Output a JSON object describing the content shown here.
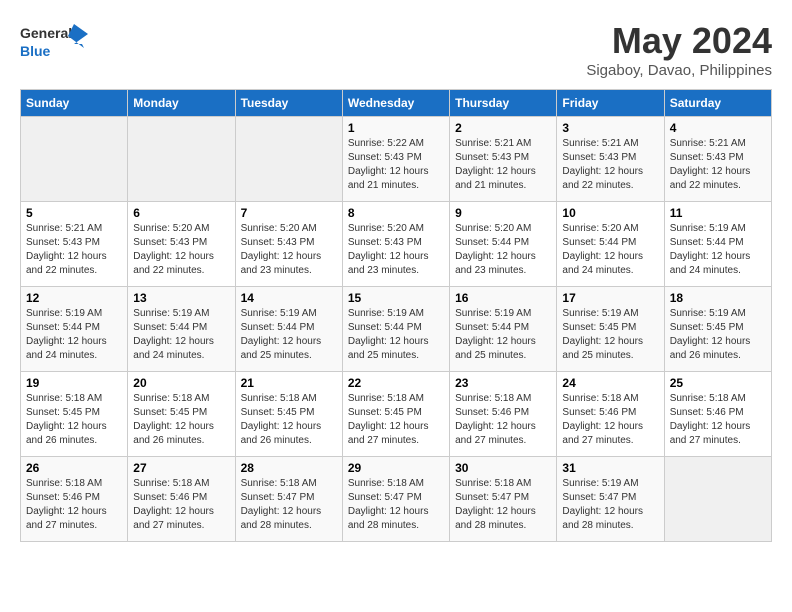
{
  "logo": {
    "line1": "General",
    "line2": "Blue"
  },
  "title": "May 2024",
  "location": "Sigaboy, Davao, Philippines",
  "days_of_week": [
    "Sunday",
    "Monday",
    "Tuesday",
    "Wednesday",
    "Thursday",
    "Friday",
    "Saturday"
  ],
  "weeks": [
    [
      {
        "day": "",
        "info": ""
      },
      {
        "day": "",
        "info": ""
      },
      {
        "day": "",
        "info": ""
      },
      {
        "day": "1",
        "info": "Sunrise: 5:22 AM\nSunset: 5:43 PM\nDaylight: 12 hours and 21 minutes."
      },
      {
        "day": "2",
        "info": "Sunrise: 5:21 AM\nSunset: 5:43 PM\nDaylight: 12 hours and 21 minutes."
      },
      {
        "day": "3",
        "info": "Sunrise: 5:21 AM\nSunset: 5:43 PM\nDaylight: 12 hours and 22 minutes."
      },
      {
        "day": "4",
        "info": "Sunrise: 5:21 AM\nSunset: 5:43 PM\nDaylight: 12 hours and 22 minutes."
      }
    ],
    [
      {
        "day": "5",
        "info": "Sunrise: 5:21 AM\nSunset: 5:43 PM\nDaylight: 12 hours and 22 minutes."
      },
      {
        "day": "6",
        "info": "Sunrise: 5:20 AM\nSunset: 5:43 PM\nDaylight: 12 hours and 22 minutes."
      },
      {
        "day": "7",
        "info": "Sunrise: 5:20 AM\nSunset: 5:43 PM\nDaylight: 12 hours and 23 minutes."
      },
      {
        "day": "8",
        "info": "Sunrise: 5:20 AM\nSunset: 5:43 PM\nDaylight: 12 hours and 23 minutes."
      },
      {
        "day": "9",
        "info": "Sunrise: 5:20 AM\nSunset: 5:44 PM\nDaylight: 12 hours and 23 minutes."
      },
      {
        "day": "10",
        "info": "Sunrise: 5:20 AM\nSunset: 5:44 PM\nDaylight: 12 hours and 24 minutes."
      },
      {
        "day": "11",
        "info": "Sunrise: 5:19 AM\nSunset: 5:44 PM\nDaylight: 12 hours and 24 minutes."
      }
    ],
    [
      {
        "day": "12",
        "info": "Sunrise: 5:19 AM\nSunset: 5:44 PM\nDaylight: 12 hours and 24 minutes."
      },
      {
        "day": "13",
        "info": "Sunrise: 5:19 AM\nSunset: 5:44 PM\nDaylight: 12 hours and 24 minutes."
      },
      {
        "day": "14",
        "info": "Sunrise: 5:19 AM\nSunset: 5:44 PM\nDaylight: 12 hours and 25 minutes."
      },
      {
        "day": "15",
        "info": "Sunrise: 5:19 AM\nSunset: 5:44 PM\nDaylight: 12 hours and 25 minutes."
      },
      {
        "day": "16",
        "info": "Sunrise: 5:19 AM\nSunset: 5:44 PM\nDaylight: 12 hours and 25 minutes."
      },
      {
        "day": "17",
        "info": "Sunrise: 5:19 AM\nSunset: 5:45 PM\nDaylight: 12 hours and 25 minutes."
      },
      {
        "day": "18",
        "info": "Sunrise: 5:19 AM\nSunset: 5:45 PM\nDaylight: 12 hours and 26 minutes."
      }
    ],
    [
      {
        "day": "19",
        "info": "Sunrise: 5:18 AM\nSunset: 5:45 PM\nDaylight: 12 hours and 26 minutes."
      },
      {
        "day": "20",
        "info": "Sunrise: 5:18 AM\nSunset: 5:45 PM\nDaylight: 12 hours and 26 minutes."
      },
      {
        "day": "21",
        "info": "Sunrise: 5:18 AM\nSunset: 5:45 PM\nDaylight: 12 hours and 26 minutes."
      },
      {
        "day": "22",
        "info": "Sunrise: 5:18 AM\nSunset: 5:45 PM\nDaylight: 12 hours and 27 minutes."
      },
      {
        "day": "23",
        "info": "Sunrise: 5:18 AM\nSunset: 5:46 PM\nDaylight: 12 hours and 27 minutes."
      },
      {
        "day": "24",
        "info": "Sunrise: 5:18 AM\nSunset: 5:46 PM\nDaylight: 12 hours and 27 minutes."
      },
      {
        "day": "25",
        "info": "Sunrise: 5:18 AM\nSunset: 5:46 PM\nDaylight: 12 hours and 27 minutes."
      }
    ],
    [
      {
        "day": "26",
        "info": "Sunrise: 5:18 AM\nSunset: 5:46 PM\nDaylight: 12 hours and 27 minutes."
      },
      {
        "day": "27",
        "info": "Sunrise: 5:18 AM\nSunset: 5:46 PM\nDaylight: 12 hours and 27 minutes."
      },
      {
        "day": "28",
        "info": "Sunrise: 5:18 AM\nSunset: 5:47 PM\nDaylight: 12 hours and 28 minutes."
      },
      {
        "day": "29",
        "info": "Sunrise: 5:18 AM\nSunset: 5:47 PM\nDaylight: 12 hours and 28 minutes."
      },
      {
        "day": "30",
        "info": "Sunrise: 5:18 AM\nSunset: 5:47 PM\nDaylight: 12 hours and 28 minutes."
      },
      {
        "day": "31",
        "info": "Sunrise: 5:19 AM\nSunset: 5:47 PM\nDaylight: 12 hours and 28 minutes."
      },
      {
        "day": "",
        "info": ""
      }
    ]
  ]
}
